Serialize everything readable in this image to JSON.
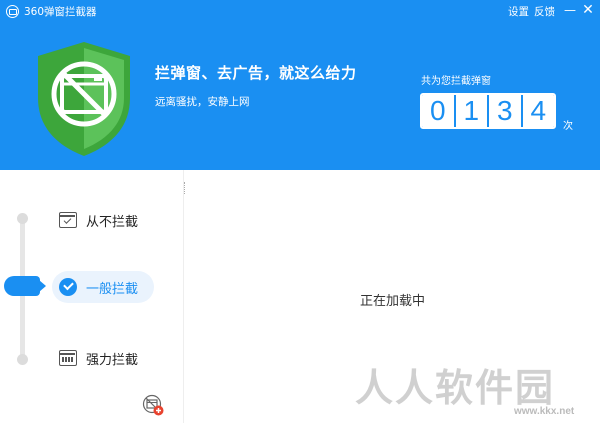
{
  "window": {
    "title": "360弹窗拦截器",
    "settings_label": "设置",
    "feedback_label": "反馈",
    "minimize_glyph": "—",
    "close_glyph": "✕"
  },
  "header": {
    "slogan": "拦弹窗、去广告，就这么给力",
    "subslogan": "远离骚扰，安静上网",
    "count_label": "共为您拦截弹窗",
    "count_digits": [
      "0",
      "1",
      "3",
      "4"
    ],
    "count_unit": "次",
    "shield_icon": "shield-no-popup-icon"
  },
  "sidebar": {
    "modes": [
      {
        "label": "从不拦截",
        "icon": "window-check-icon",
        "selected": false
      },
      {
        "label": "一般拦截",
        "icon": "circle-check-icon",
        "selected": true
      },
      {
        "label": "强力拦截",
        "icon": "window-strong-icon",
        "selected": false
      }
    ],
    "add_icon": "add-blocked-window-icon"
  },
  "main": {
    "loading_text": "正在加载中"
  },
  "watermark": {
    "text": "人人软件园",
    "url": "www.kkx.net"
  },
  "colors": {
    "accent": "#1a8ff2",
    "shield_green": "#4cb84a",
    "selected_bg": "#eaf3fd"
  }
}
